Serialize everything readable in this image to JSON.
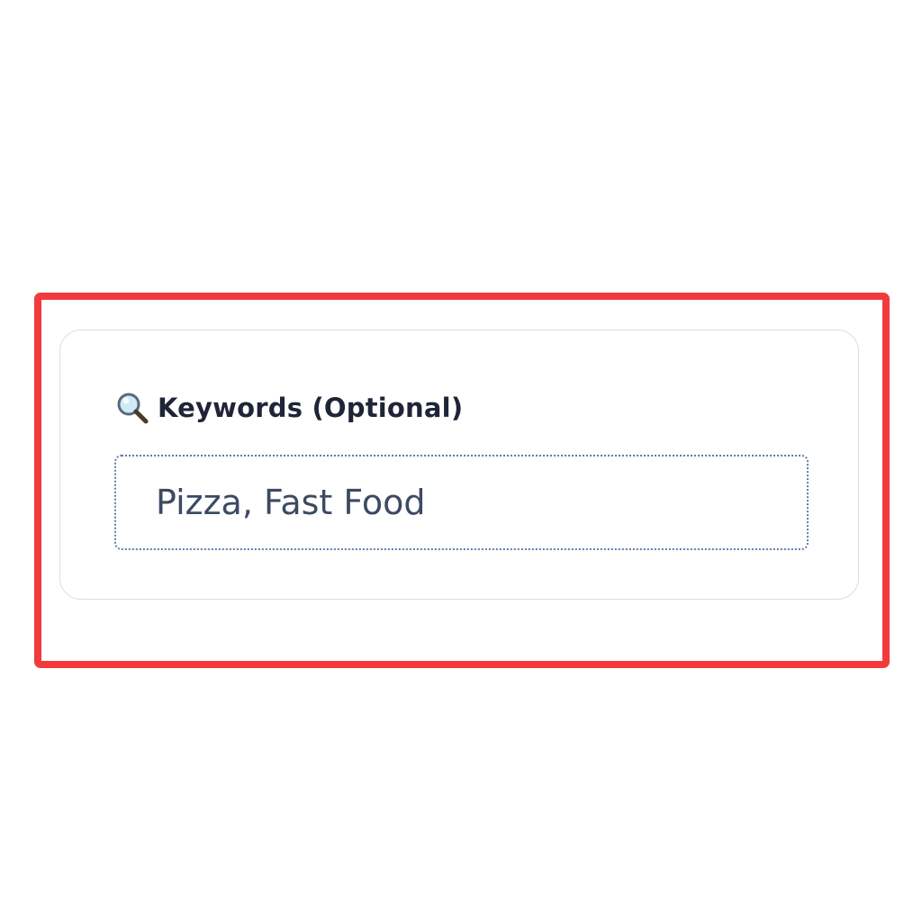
{
  "keywords_field": {
    "label": "Keywords (Optional)",
    "icon": "magnifying-glass-icon",
    "value": "Pizza, Fast Food"
  },
  "colors": {
    "highlight_border": "#f23a3c",
    "label_text": "#1e2537",
    "input_text": "#3c4a63",
    "input_border": "#5f7fa8",
    "card_border": "#d9dde3"
  }
}
